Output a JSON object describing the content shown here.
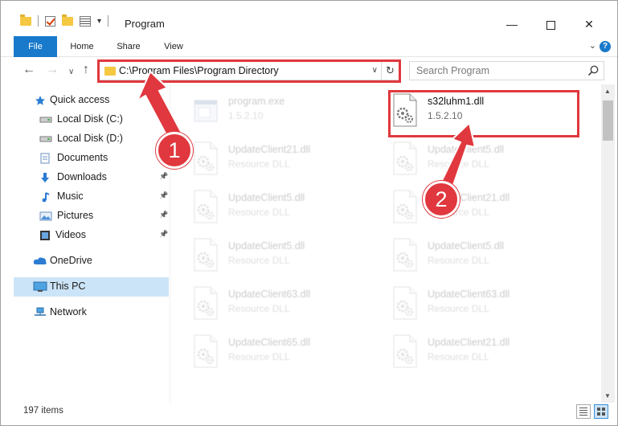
{
  "window": {
    "title": "Program",
    "minimize": "—",
    "close": "✕"
  },
  "ribbon": {
    "tabs": [
      "File",
      "Home",
      "Share",
      "View"
    ],
    "help": "?"
  },
  "address_bar": {
    "path": "C:\\Program Files\\Program Directory"
  },
  "search": {
    "placeholder": "Search Program"
  },
  "sidebar": {
    "items": [
      {
        "label": "Quick access",
        "icon": "star-icon"
      },
      {
        "label": "Local Disk (C:)",
        "icon": "drive-icon"
      },
      {
        "label": "Local Disk (D:)",
        "icon": "drive-icon"
      },
      {
        "label": "Documents",
        "icon": "documents-icon"
      },
      {
        "label": "Downloads",
        "icon": "download-arrow-icon"
      },
      {
        "label": "Music",
        "icon": "music-note-icon"
      },
      {
        "label": "Pictures",
        "icon": "pictures-icon"
      },
      {
        "label": "Videos",
        "icon": "videos-icon"
      },
      {
        "label": "OneDrive",
        "icon": "cloud-icon"
      },
      {
        "label": "This PC",
        "icon": "computer-icon"
      },
      {
        "label": "Network",
        "icon": "network-icon"
      }
    ]
  },
  "files": [
    {
      "name": "program.exe",
      "sub": "1.5.2.10",
      "faded": true
    },
    {
      "name": "s32luhm1.dll",
      "sub": "1.5.2.10",
      "faded": false
    },
    {
      "name": "UpdateClient21.dll",
      "sub": "Resource DLL",
      "faded": true
    },
    {
      "name": "UpdateClient5.dll",
      "sub": "Resource DLL",
      "faded": true
    },
    {
      "name": "UpdateClient5.dll",
      "sub": "Resource DLL",
      "faded": true
    },
    {
      "name": "UpdateClient21.dll",
      "sub": "Resource DLL",
      "faded": true
    },
    {
      "name": "UpdateClient5.dll",
      "sub": "Resource DLL",
      "faded": true
    },
    {
      "name": "UpdateClient5.dll",
      "sub": "Resource DLL",
      "faded": true
    },
    {
      "name": "UpdateClient63.dll",
      "sub": "Resource DLL",
      "faded": true
    },
    {
      "name": "UpdateClient63.dll",
      "sub": "Resource DLL",
      "faded": true
    },
    {
      "name": "UpdateClient65.dll",
      "sub": "Resource DLL",
      "faded": true
    },
    {
      "name": "UpdateClient21.dll",
      "sub": "Resource DLL",
      "faded": true
    }
  ],
  "status": {
    "item_count": "197 items"
  },
  "callouts": [
    "1",
    "2"
  ],
  "colors": {
    "accent": "#1979ca",
    "highlight": "#e0383e",
    "selected": "#cce4f7"
  }
}
